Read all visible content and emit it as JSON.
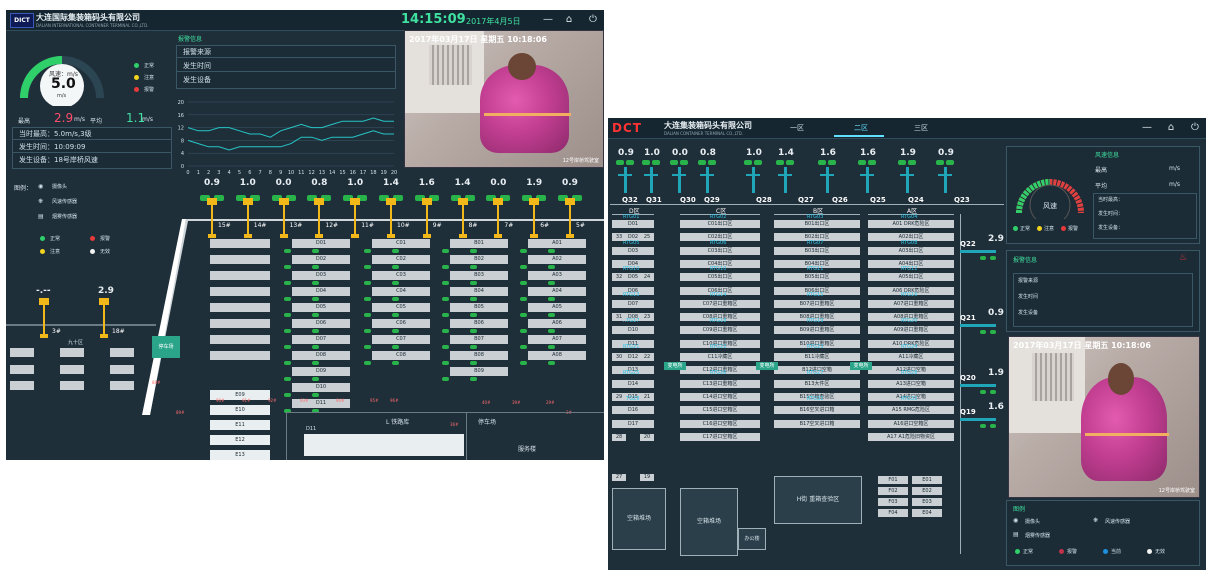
{
  "left_screen": {
    "company_cn": "大连国际集装箱码头有限公司",
    "company_en": "DALIAN INTERNATIONAL CONTAINER TERMINAL CO.,LTD.",
    "logo": "DICT",
    "clock": "14:15:09",
    "date": "2017年4月5日",
    "gauge": {
      "label": "风速：m/s",
      "value": "5.0",
      "unit": "m/s",
      "level": 0.5
    },
    "status_legend": [
      {
        "label": "正常",
        "color": "#2fd06a"
      },
      {
        "label": "注意",
        "color": "#f2d41f"
      },
      {
        "label": "报警",
        "color": "#e83a3a"
      }
    ],
    "max_label": "最高",
    "max_value": "2.9",
    "max_unit": "m/s",
    "avg_label": "平均",
    "avg_value": "1.1",
    "avg_unit": "m/s",
    "info_lines": [
      "当时最高：5.0m/s,3级",
      "发生时间：10:09:09",
      "发生设备：18号岸桥风速"
    ],
    "alarm_title": "报警信息",
    "alarm_rows": [
      "报警来源",
      "发生时间",
      "发生设备"
    ],
    "camera": {
      "timestamp": "2017年03月17日 星期五 10:18:06",
      "label": "12号岸桥驾驶室"
    },
    "chart_data": {
      "type": "line",
      "x": [
        0,
        1,
        2,
        3,
        4,
        5,
        6,
        7,
        8,
        9,
        10,
        11,
        12,
        13,
        14,
        15,
        16,
        17,
        18,
        19,
        20
      ],
      "series": [
        {
          "values": [
            12,
            11,
            11,
            12,
            12,
            11,
            10,
            10,
            9,
            11,
            12,
            13,
            12,
            12,
            13,
            14,
            14,
            14,
            15,
            14,
            14
          ],
          "color": "#26c6c6"
        },
        {
          "values": [
            8,
            7,
            6,
            6,
            5,
            6,
            6,
            6,
            6,
            6,
            7,
            9,
            9,
            8,
            9,
            9,
            9,
            10,
            11,
            10,
            10
          ],
          "color": "#26c6c6"
        }
      ],
      "yticks": [
        0,
        4,
        8,
        12,
        16,
        20
      ],
      "xticks": [
        0,
        1,
        2,
        3,
        4,
        5,
        6,
        7,
        8,
        9,
        10,
        11,
        12,
        13,
        14,
        15,
        16,
        17,
        18,
        19,
        20
      ],
      "ylim": [
        0,
        20
      ]
    },
    "legend": {
      "title": "图例：",
      "items": [
        "摄像头",
        "风速传感器",
        "烟雾传感器"
      ],
      "status": [
        "正常",
        "报警",
        "注意",
        "无效"
      ]
    },
    "crane_values": [
      "0.9",
      "1.0",
      "0.0",
      "0.8",
      "1.0",
      "1.4",
      "1.6",
      "1.4",
      "0.0",
      "1.9",
      "0.9"
    ],
    "crane_ids": [
      "15#",
      "14#",
      "13#",
      "12#",
      "11#",
      "10#",
      "9#",
      "8#",
      "7#",
      "6#",
      "5#"
    ],
    "left_cranes": [
      {
        "value": "-.--",
        "id": "3#"
      },
      {
        "value": "2.9",
        "id": "18#"
      }
    ],
    "area_label": "九十区",
    "parking_label": "停车场",
    "cols": {
      "D0": [
        "D01",
        "D02",
        "D03",
        "D04",
        "D05",
        "D06",
        "D07",
        "D08",
        "D09",
        "D10",
        "D11"
      ],
      "C0": [
        "C01",
        "C02",
        "C03",
        "C04",
        "C05",
        "C06",
        "C07",
        "C08"
      ],
      "B0": [
        "B01",
        "B02",
        "B03",
        "B04",
        "B05",
        "B06",
        "B07",
        "B08",
        "B09"
      ],
      "A0": [
        "A01",
        "A02",
        "A03",
        "A04",
        "A05",
        "A06",
        "A07",
        "A08"
      ],
      "E": [
        "E09",
        "E10",
        "E11",
        "E12",
        "E13"
      ]
    },
    "bottom_labels": [
      "L 铁路库",
      "停车场",
      "服务楼",
      "D11"
    ],
    "small_tags": [
      "89#",
      "90#",
      "91#",
      "92#",
      "93#",
      "94#",
      "95#",
      "96#",
      "88#",
      "42#",
      "7#",
      "36#",
      "40#",
      "39#",
      "29#",
      "3#"
    ]
  },
  "right_screen": {
    "company_cn": "大连集装箱码头有限公司",
    "company_en": "DALIAN CONTAINER TERMINAL CO.,LTD.",
    "logo": "DCT",
    "tabs": [
      "一区",
      "二区",
      "三区"
    ],
    "active_tab": 1,
    "crane_values": [
      "0.9",
      "1.0",
      "0.0",
      "0.8",
      "1.0",
      "1.4",
      "1.6",
      "1.6",
      "1.9",
      "0.9"
    ],
    "quay_ids": [
      "Q32",
      "Q31",
      "Q30",
      "Q29",
      "Q28",
      "Q27",
      "Q26",
      "Q25",
      "Q24",
      "Q23"
    ],
    "zones": [
      "D区",
      "C区",
      "B区",
      "A区"
    ],
    "side_quays": [
      {
        "id": "Q22",
        "value": "2.9"
      },
      {
        "id": "Q21",
        "value": "0.9"
      },
      {
        "id": "Q20",
        "value": "1.9"
      },
      {
        "id": "Q19",
        "value": "1.6"
      }
    ],
    "wind_title": "风速信息",
    "wind_gauge_label": "风速",
    "wind_rows": [
      {
        "k": "最高",
        "u": "m/s"
      },
      {
        "k": "平均",
        "u": "m/s"
      }
    ],
    "wind_info": [
      "当时最高：",
      "发生时间：",
      "发生设备："
    ],
    "status": [
      "正常",
      "注意",
      "报警"
    ],
    "alarm_title": "报警信息",
    "alarm_rows": [
      "报警来源",
      "发生时间",
      "发生设备"
    ],
    "camera": {
      "timestamp": "2017年03月17日 星期五 10:18:06",
      "label": "12号岸桥驾驶室"
    },
    "legend_title": "图例",
    "legend_items": [
      "摄像头",
      "风速传感器",
      "烟雾传感器"
    ],
    "legend_status": [
      "正常",
      "报警",
      "当前",
      "无效"
    ],
    "d_col": [
      "D01",
      "D02",
      "D03",
      "D04",
      "D05",
      "D06",
      "D07",
      "D08",
      "D10",
      "D11",
      "D12",
      "D13",
      "D14",
      "D15",
      "D16",
      "D17"
    ],
    "d_rtg": [
      "RTG01",
      "RTG05",
      "RTG10",
      "RTG13",
      "RTG17",
      "RTG21",
      "RTG25",
      "RTG29"
    ],
    "c_col": [
      "C01出口区",
      "C02出口区",
      "C03出口区",
      "C04出口区",
      "C05出口区",
      "C06出口区",
      "C07进口重箱区",
      "C08进口重箱区",
      "C09进口重箱区",
      "C10进口重箱区",
      "C11冷藏区",
      "C12进口重箱区",
      "C13进口重箱区",
      "C14进口空箱区",
      "C15进口空箱区",
      "C16进口空箱区",
      "C17进口空箱区"
    ],
    "c_rtg": [
      "RTG02",
      "RTG06",
      "RTG10",
      "RTG14",
      "RTG18",
      "RTG22",
      "RTG26"
    ],
    "b_col": [
      "B01出口区",
      "B02出口区",
      "B03出口区",
      "B04出口区",
      "B05出口区",
      "B06出口区",
      "B07进口重箱区",
      "B08进口重箱区",
      "B09进口重箱区",
      "B10进口重箱区",
      "B11冷藏区",
      "B12进口空箱",
      "B13大件区",
      "B15空箱查验区",
      "B16空叉进口箱",
      "B17空叉进口箱"
    ],
    "b_rtg": [
      "RTG03",
      "RTG07",
      "RTG11",
      "RTG15",
      "RTG19",
      "RTG23",
      "RTG27",
      "RTG31"
    ],
    "a_col": [
      "A01 DRK危险区",
      "A02出口区",
      "A03出口区",
      "A04出口区",
      "A05出口区",
      "A06 DRK危险区",
      "A07进口重箱区",
      "A08进口重箱区",
      "A09进口重箱区",
      "A10 DRK危险区",
      "A11冷藏区",
      "A12进口空箱",
      "A13进口空箱",
      "A14进口空箱",
      "A15 RMG危险区",
      "A16进口空箱区",
      "A17 A1危险旧物资区"
    ],
    "a_rtg": [
      "RTG04",
      "RTG08",
      "RTG12",
      "RTG16",
      "RTG20",
      "RTG24",
      "RTG28",
      "RTG32"
    ],
    "substation": "变电所",
    "bottom": {
      "empty1": "空箱堆场",
      "empty2": "空箱堆场",
      "h_block": "H街 重箱查验区",
      "office": "办公楼",
      "f_rows": [
        [
          "F01",
          "E01"
        ],
        [
          "F02",
          "E02"
        ],
        [
          "F03",
          "E03"
        ],
        [
          "F04",
          "E04"
        ]
      ]
    },
    "row_nums": [
      "33",
      "32",
      "31",
      "30",
      "29",
      "28",
      "27",
      "26",
      "25",
      "24",
      "23",
      "22",
      "21",
      "20",
      "19",
      "18",
      "17",
      "16",
      "15",
      "14",
      "13",
      "12",
      "11",
      "10",
      "9",
      "8",
      "7",
      "6",
      "5",
      "4",
      "3",
      "2",
      "1",
      "34",
      "35",
      "36",
      "37",
      "38",
      "39",
      "40",
      "41",
      "42",
      "43",
      "44",
      "45",
      "46",
      "47"
    ]
  }
}
